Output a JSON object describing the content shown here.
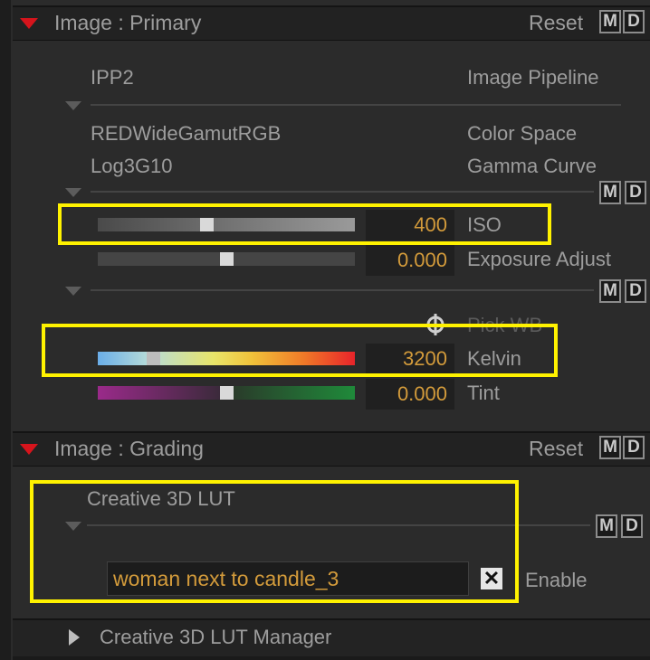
{
  "primary": {
    "title": "Image : Primary",
    "reset_label": "Reset",
    "m_label": "M",
    "d_label": "D",
    "pipeline": {
      "value": "IPP2",
      "label": "Image Pipeline"
    },
    "color_space": {
      "value": "REDWideGamutRGB",
      "label": "Color Space"
    },
    "gamma_curve": {
      "value": "Log3G10",
      "label": "Gamma Curve"
    },
    "iso": {
      "value": "400",
      "label": "ISO",
      "slider_fraction": 0.42
    },
    "exposure": {
      "value": "0.000",
      "label": "Exposure Adjust",
      "slider_fraction": 0.5
    },
    "pick_wb_label": "Pick WB",
    "kelvin": {
      "value": "3200",
      "label": "Kelvin",
      "slider_fraction": 0.2
    },
    "tint": {
      "value": "0.000",
      "label": "Tint",
      "slider_fraction": 0.5
    }
  },
  "grading": {
    "title": "Image : Grading",
    "reset_label": "Reset",
    "m_label": "M",
    "d_label": "D",
    "lut_label": "Creative 3D LUT",
    "lut_value": "woman next to candle_3",
    "clear_glyph": "✕",
    "enable_label": "Enable"
  },
  "lut_manager": {
    "label": "Creative 3D LUT Manager"
  },
  "colors": {
    "accent_value": "#d39b3b",
    "highlight": "#fff200",
    "collapse_arrow": "#d6141c"
  }
}
